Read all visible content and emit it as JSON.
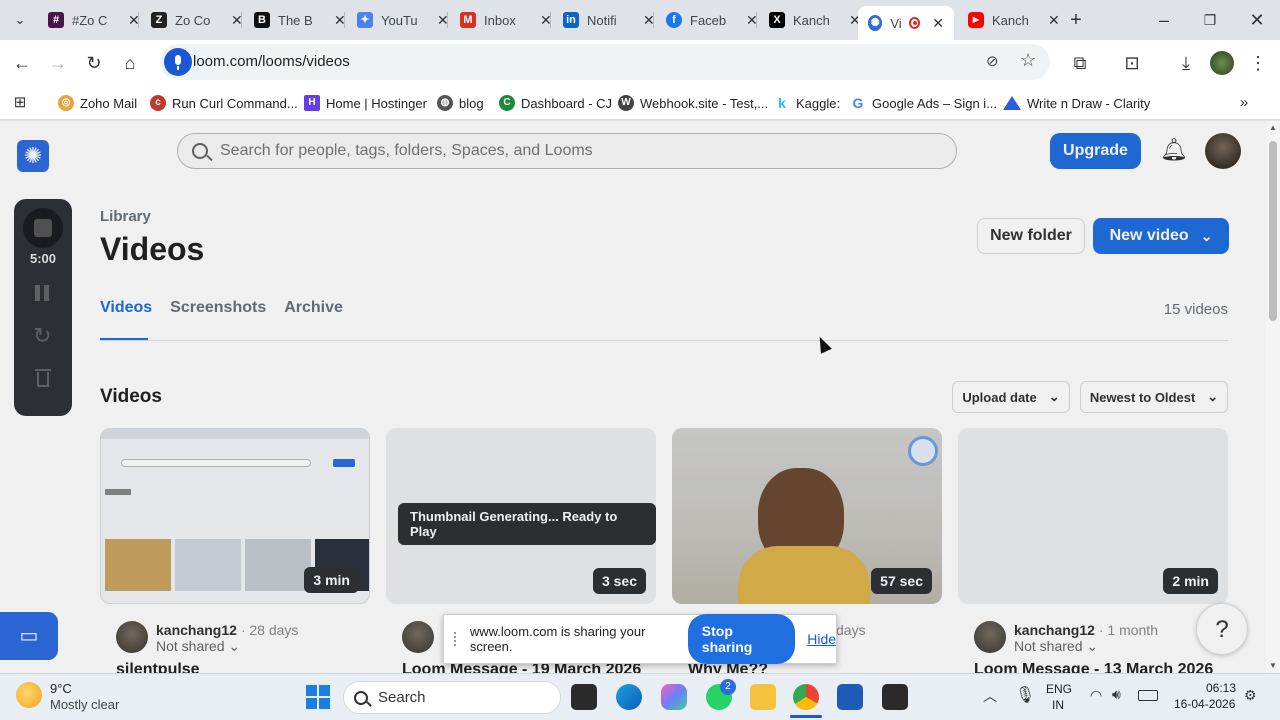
{
  "browser": {
    "tabs": [
      {
        "label": "#Zo C",
        "icon": "slack-icon",
        "color": "#4a154b"
      },
      {
        "label": "Zo Co",
        "icon": "zo-icon",
        "color": "#222222"
      },
      {
        "label": "The B",
        "icon": "the-b-icon",
        "color": "#111111"
      },
      {
        "label": "YouTu",
        "icon": "gemini-icon",
        "color": "#4a82f0"
      },
      {
        "label": "Inbox",
        "icon": "gmail-icon",
        "color": "#d93025"
      },
      {
        "label": "Notifi",
        "icon": "linkedin-icon",
        "color": "#0a66c2"
      },
      {
        "label": "Faceb",
        "icon": "facebook-icon",
        "color": "#1877f2"
      },
      {
        "label": "Kanch",
        "icon": "x-icon",
        "color": "#000000"
      },
      {
        "label": "Vi",
        "icon": "loom-icon",
        "color": "#2d6cdf"
      },
      {
        "label": "Kanch",
        "icon": "youtube-icon",
        "color": "#ff0000"
      }
    ],
    "url": "loom.com/looms/videos",
    "bookmarks": [
      {
        "label": "Zoho Mail",
        "color": "#e8a33a"
      },
      {
        "label": "Run Curl Command...",
        "color": "#c0392b"
      },
      {
        "label": "Home | Hostinger",
        "color": "#673de6"
      },
      {
        "label": "blog",
        "color": "#555555"
      },
      {
        "label": "Dashboard - CJ",
        "color": "#1b8a3c"
      },
      {
        "label": "Webhook.site - Test,...",
        "color": "#444444"
      },
      {
        "label": "Kaggle:",
        "color": "#20beff"
      },
      {
        "label": "Google Ads – Sign i...",
        "color": "#4285f4"
      },
      {
        "label": "Write n Draw - Clarity",
        "color": "#2d5be3"
      }
    ]
  },
  "header": {
    "search_placeholder": "Search for people, tags, folders, Spaces, and Looms",
    "upgrade_label": "Upgrade"
  },
  "library": {
    "breadcrumb": "Library",
    "title": "Videos",
    "new_folder_label": "New folder",
    "new_video_label": "New video",
    "tabs": [
      "Videos",
      "Screenshots",
      "Archive"
    ],
    "video_count": "15 videos",
    "section_title": "Videos",
    "sort_field": "Upload date",
    "sort_order": "Newest to Oldest"
  },
  "recorder": {
    "timer": "5:00"
  },
  "videos": [
    {
      "author": "kanchang12",
      "age": "28 days",
      "sharing": "Not shared",
      "duration": "3 min",
      "title": "silentpulse"
    },
    {
      "author": "",
      "age": "",
      "sharing": "",
      "duration": "3 sec",
      "title": "Loom Message - 19 March 2026",
      "status": "Thumbnail Generating... Ready to Play"
    },
    {
      "author": "",
      "age": "days",
      "sharing": "",
      "duration": "57 sec",
      "title": "Why Me??"
    },
    {
      "author": "kanchang12",
      "age": "1 month",
      "sharing": "Not shared",
      "duration": "2 min",
      "title": "Loom Message - 13 March 2026"
    }
  ],
  "sharebar": {
    "message": "www.loom.com is sharing your screen.",
    "stop_label": "Stop sharing",
    "hide_label": "Hide"
  },
  "help": {
    "label": "?"
  },
  "taskbar": {
    "weather_temp": "9°C",
    "weather_desc": "Mostly clear",
    "search_label": "Search",
    "whatsapp_badge": "2",
    "lang_line1": "ENG",
    "lang_line2": "IN",
    "time": "06:13",
    "date": "16-04-2026"
  }
}
